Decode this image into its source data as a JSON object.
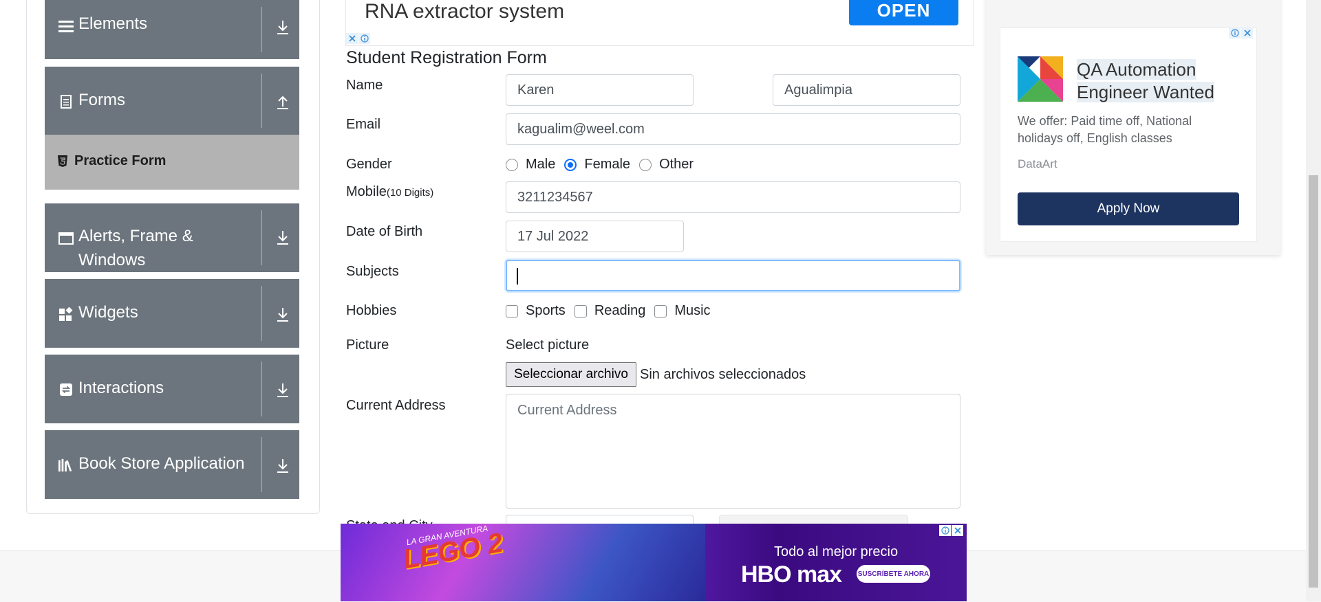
{
  "sidebar": {
    "groups": [
      {
        "label": "Elements",
        "icon": "hamburger-icon",
        "arrow": "download-arrow-icon"
      },
      {
        "label": "Forms",
        "icon": "document-icon",
        "arrow": "upload-arrow-icon"
      },
      {
        "label": "Alerts, Frame &",
        "label2": "Windows",
        "icon": "window-icon",
        "arrow": "download-arrow-icon"
      },
      {
        "label": "Widgets",
        "icon": "widgets-icon",
        "arrow": "download-arrow-icon"
      },
      {
        "label": "Interactions",
        "icon": "interactions-icon",
        "arrow": "download-arrow-icon"
      },
      {
        "label": "Book Store Application",
        "icon": "books-icon",
        "arrow": "download-arrow-icon"
      }
    ],
    "active_item": {
      "label": "Practice Form",
      "icon": "html5-icon"
    }
  },
  "top_ad": {
    "title": "RNA extractor system",
    "button": "OPEN"
  },
  "form": {
    "title": "Student Registration Form",
    "name_label": "Name",
    "first_name": "Karen",
    "last_name": "Agualimpia",
    "email_label": "Email",
    "email": "kagualim@weel.com",
    "gender_label": "Gender",
    "gender_options": [
      "Male",
      "Female",
      "Other"
    ],
    "gender_selected": "Female",
    "mobile_label": "Mobile",
    "mobile_hint": "(10 Digits)",
    "mobile": "3211234567",
    "dob_label": "Date of Birth",
    "dob": "17 Jul 2022",
    "subjects_label": "Subjects",
    "subjects": "",
    "hobbies_label": "Hobbies",
    "hobbies": [
      "Sports",
      "Reading",
      "Music"
    ],
    "picture_label": "Picture",
    "picture_prompt": "Select picture",
    "file_button": "Seleccionar archivo",
    "file_status": "Sin archivos seleccionados",
    "address_label": "Current Address",
    "address_placeholder": "Current Address",
    "state_label": "State and City"
  },
  "right_ad": {
    "title_line1": "QA Automation",
    "title_line2": "Engineer Wanted",
    "description": "We offer: Paid time off, National holidays off, English classes",
    "brand": "DataArt",
    "button": "Apply Now"
  },
  "bottom_ad": {
    "lego_sub": "LA GRAN AVENTURA",
    "lego_title": "LEGO 2",
    "promo": "Todo al mejor precio",
    "brand": "HBO max",
    "button": "SUSCRÍBETE AHORA"
  },
  "colors": {
    "sidebar_bg": "#6c757d",
    "active_bg": "#b3b3b3",
    "primary": "#0d6efd",
    "apply_bg": "#1d3461",
    "open_bg": "#0a7df0"
  }
}
